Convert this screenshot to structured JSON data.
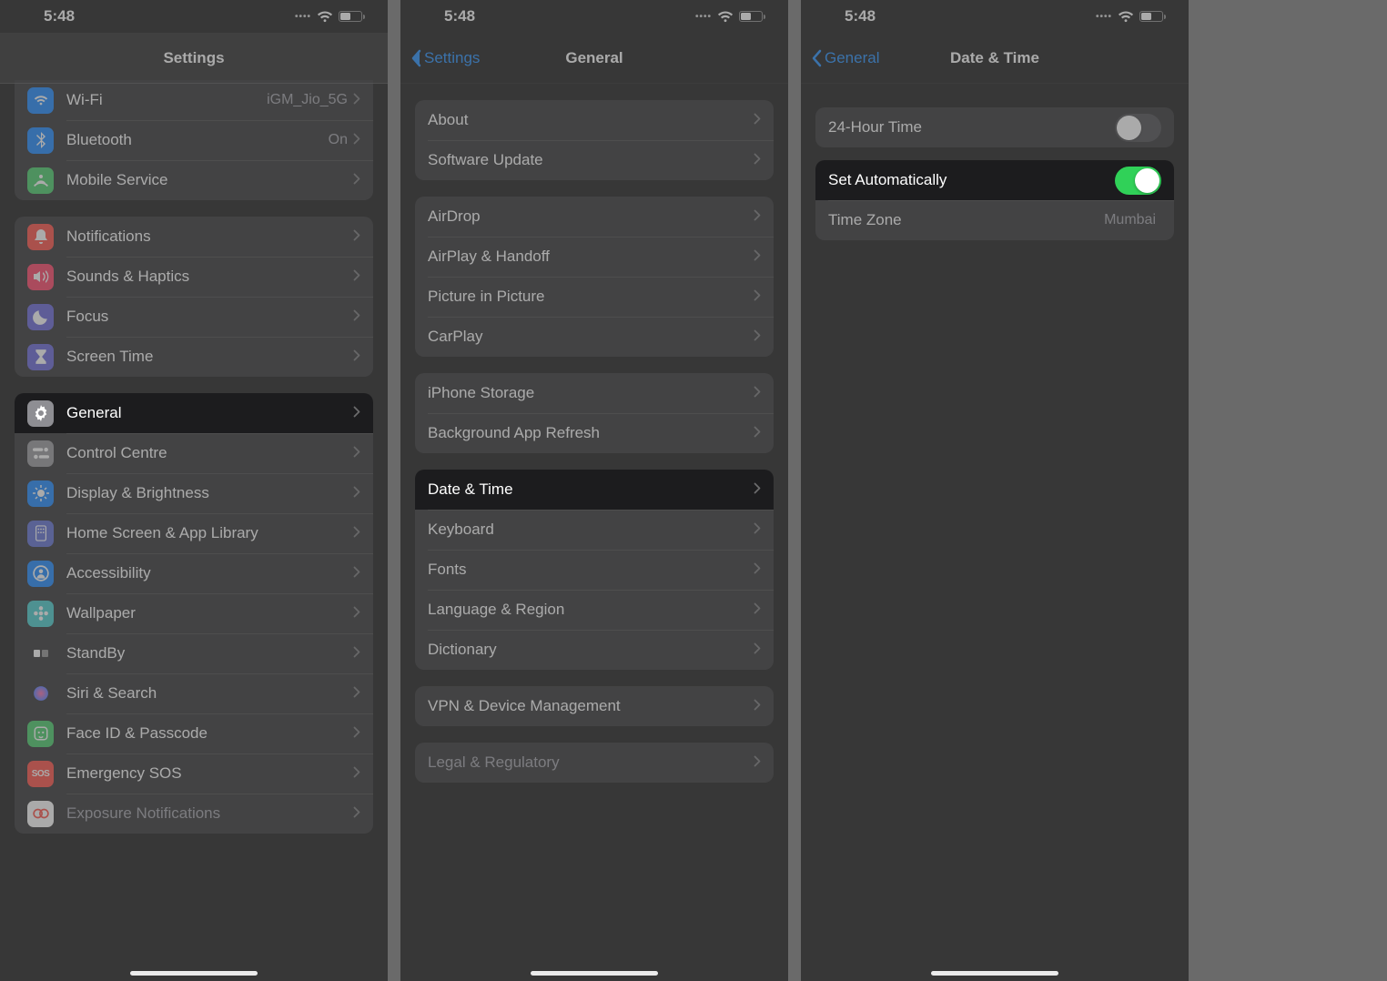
{
  "status_time": "5:48",
  "phone1": {
    "title": "Settings",
    "groups": [
      {
        "first": true,
        "items": [
          {
            "name": "wifi",
            "icon_bg": "#007aff",
            "svg": "wifi",
            "label": "Wi-Fi",
            "detail": "iGM_Jio_5G",
            "chevron": true
          },
          {
            "name": "bluetooth",
            "icon_bg": "#007aff",
            "svg": "bluetooth",
            "label": "Bluetooth",
            "detail": "On",
            "chevron": true
          },
          {
            "name": "mobile",
            "icon_bg": "#34c759",
            "svg": "antenna",
            "label": "Mobile Service",
            "detail": "",
            "chevron": true
          }
        ]
      },
      {
        "items": [
          {
            "name": "notifications",
            "icon_bg": "#ff3b30",
            "svg": "bell",
            "label": "Notifications",
            "chevron": true
          },
          {
            "name": "sounds",
            "icon_bg": "#ff2d55",
            "svg": "speaker",
            "label": "Sounds & Haptics",
            "chevron": true
          },
          {
            "name": "focus",
            "icon_bg": "#5856d6",
            "svg": "moon",
            "label": "Focus",
            "chevron": true
          },
          {
            "name": "screentime",
            "icon_bg": "#5856d6",
            "svg": "hourglass",
            "label": "Screen Time",
            "chevron": true
          }
        ]
      },
      {
        "items": [
          {
            "name": "general",
            "icon_bg": "#8e8e93",
            "svg": "gear",
            "label": "General",
            "chevron": true,
            "highlight": true
          },
          {
            "name": "controlcentre",
            "icon_bg": "#8e8e93",
            "svg": "switches",
            "label": "Control Centre",
            "chevron": true
          },
          {
            "name": "display",
            "icon_bg": "#007aff",
            "svg": "sun",
            "label": "Display & Brightness",
            "chevron": true
          },
          {
            "name": "homescreen",
            "icon_bg": "#4f5fcf",
            "svg": "grid",
            "label": "Home Screen & App Library",
            "chevron": true
          },
          {
            "name": "accessibility",
            "icon_bg": "#007aff",
            "svg": "person",
            "label": "Accessibility",
            "chevron": true
          },
          {
            "name": "wallpaper",
            "icon_bg": "#33c7c7",
            "svg": "flower",
            "label": "Wallpaper",
            "chevron": true
          },
          {
            "name": "standby",
            "icon_bg": "#1c1c1e",
            "svg": "clock",
            "label": "StandBy",
            "chevron": true
          },
          {
            "name": "siri",
            "icon_bg": "#1c1c1e",
            "svg": "siri",
            "label": "Siri & Search",
            "chevron": true
          },
          {
            "name": "faceid",
            "icon_bg": "#34c759",
            "svg": "face",
            "label": "Face ID & Passcode",
            "chevron": true
          },
          {
            "name": "sos",
            "icon_bg": "#ff3b30",
            "svg": "sos",
            "label": "Emergency SOS",
            "chevron": true
          },
          {
            "name": "exposure",
            "icon_bg": "#ffffff",
            "svg": "exposure",
            "label": "Exposure Notifications",
            "chevron": true,
            "cut": true
          }
        ]
      }
    ]
  },
  "phone2": {
    "back": "Settings",
    "title": "General",
    "groups": [
      {
        "items": [
          {
            "name": "about",
            "label": "About",
            "chevron": true
          },
          {
            "name": "software-update",
            "label": "Software Update",
            "chevron": true
          }
        ]
      },
      {
        "items": [
          {
            "name": "airdrop",
            "label": "AirDrop",
            "chevron": true
          },
          {
            "name": "airplay",
            "label": "AirPlay & Handoff",
            "chevron": true
          },
          {
            "name": "pip",
            "label": "Picture in Picture",
            "chevron": true
          },
          {
            "name": "carplay",
            "label": "CarPlay",
            "chevron": true
          }
        ]
      },
      {
        "items": [
          {
            "name": "storage",
            "label": "iPhone Storage",
            "chevron": true
          },
          {
            "name": "refresh",
            "label": "Background App Refresh",
            "chevron": true
          }
        ]
      },
      {
        "items": [
          {
            "name": "datetime",
            "label": "Date & Time",
            "chevron": true,
            "highlight": true
          },
          {
            "name": "keyboard",
            "label": "Keyboard",
            "chevron": true
          },
          {
            "name": "fonts",
            "label": "Fonts",
            "chevron": true
          },
          {
            "name": "language",
            "label": "Language & Region",
            "chevron": true
          },
          {
            "name": "dictionary",
            "label": "Dictionary",
            "chevron": true
          }
        ]
      },
      {
        "items": [
          {
            "name": "vpn",
            "label": "VPN & Device Management",
            "chevron": true
          }
        ]
      },
      {
        "items": [
          {
            "name": "legal",
            "label": "Legal & Regulatory",
            "chevron": true,
            "cut": true
          }
        ]
      }
    ]
  },
  "phone3": {
    "back": "General",
    "title": "Date & Time",
    "twentyFourHour": {
      "label": "24-Hour Time",
      "on": false
    },
    "setAuto": {
      "label": "Set Automatically",
      "on": true
    },
    "timezone": {
      "label": "Time Zone",
      "value": "Mumbai"
    }
  }
}
